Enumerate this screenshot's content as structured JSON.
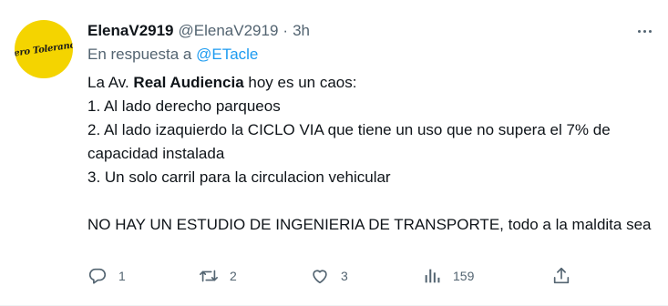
{
  "user": {
    "name": "ElenaV2919",
    "handle": "@ElenaV2919",
    "separator": "·",
    "time": "3h",
    "avatar_text": "Zero Tolerance",
    "avatar_color": "#f4d400"
  },
  "reply": {
    "prefix": "En respuesta a",
    "mention": "@ETacle"
  },
  "tweet": {
    "line1_pre": "La Av. ",
    "line1_bold": "Real Audiencia",
    "line1_post": " hoy es un caos:",
    "line2": "1. Al lado derecho parqueos",
    "line3": "2. Al lado izaquierdo la CICLO VIA que tiene un uso que no supera el 7% de capacidad instalada",
    "line4": "3. Un solo carril para la circulacion vehicular",
    "line5": "NO HAY UN ESTUDIO DE INGENIERIA DE TRANSPORTE, todo a la maldita sea"
  },
  "actions": {
    "replies": "1",
    "retweets": "2",
    "likes": "3",
    "views": "159"
  },
  "colors": {
    "text": "#0f1419",
    "secondary": "#536471",
    "link": "#1d9bf0"
  }
}
